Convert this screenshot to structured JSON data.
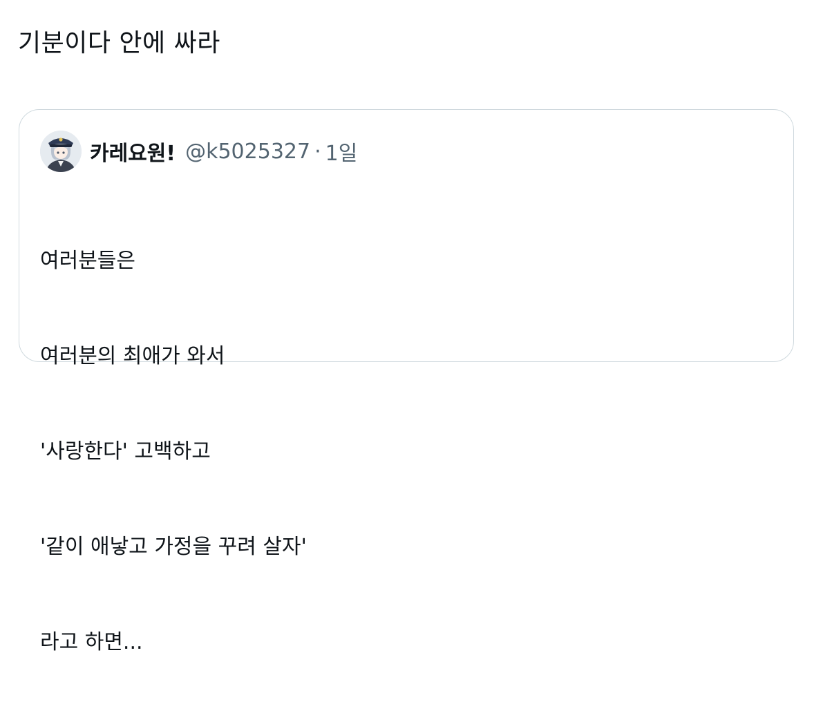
{
  "tweet": {
    "text": "기분이다 안에 싸라"
  },
  "quoted": {
    "display_name": "카레요원!",
    "handle": "@k5025327",
    "separator": "·",
    "time": "1일",
    "avatar_icon": "anime-character-avatar",
    "lines": [
      "여러분들은",
      "여러분의 최애가 와서",
      "'사랑한다' 고백하고",
      "'같이 애낳고 가정을 꾸려 살자'",
      "라고 하면..."
    ]
  },
  "colors": {
    "text": "#0f1419",
    "secondary": "#536471",
    "border": "#cfd9de"
  }
}
